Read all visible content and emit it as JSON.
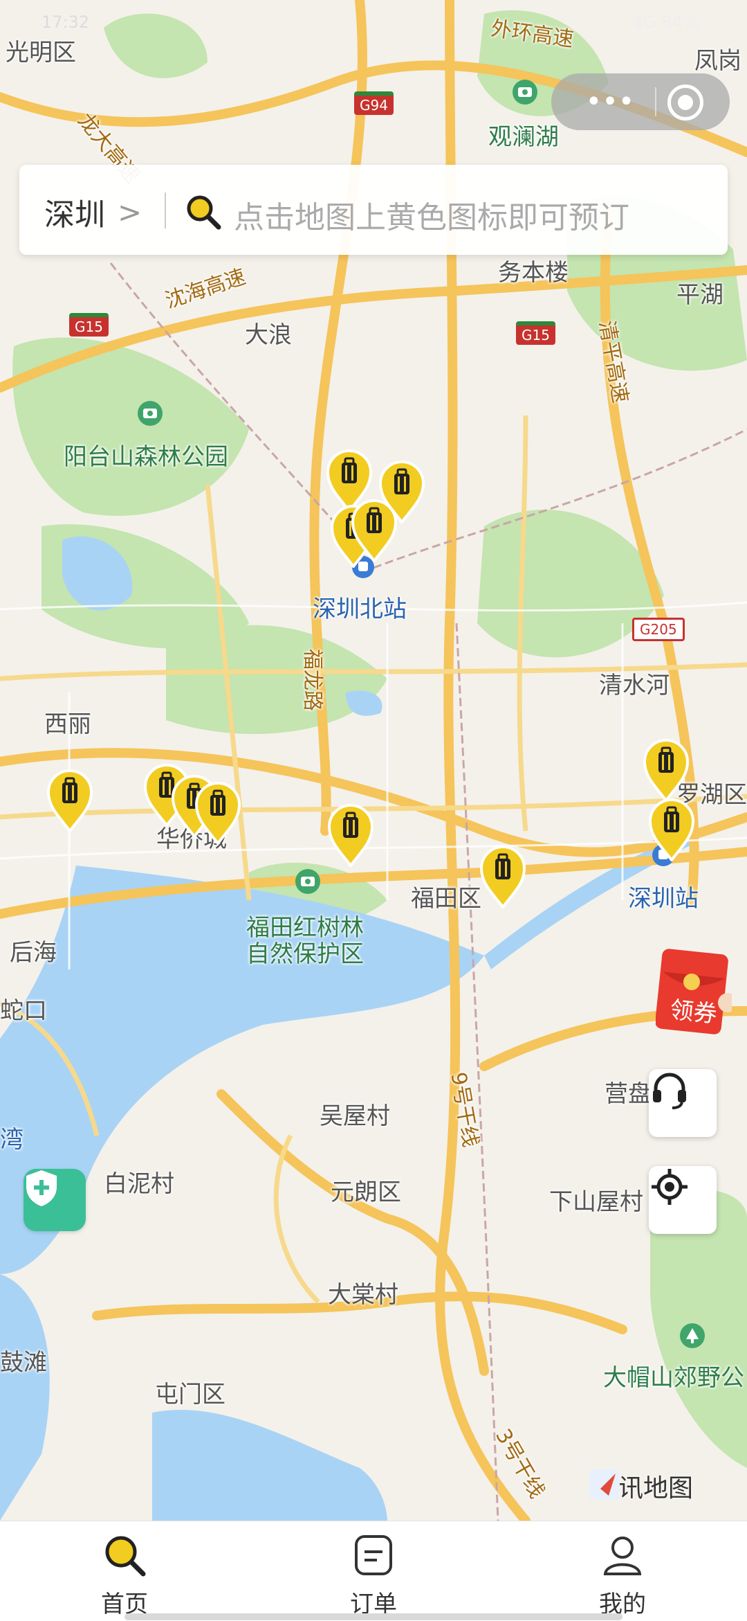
{
  "status_bar": {
    "time": "17:32",
    "right": "4G 84%"
  },
  "capsule": {
    "more_label": "•••"
  },
  "search": {
    "city": "深圳",
    "placeholder": "点击地图上黄色图标即可预订"
  },
  "map": {
    "labels": [
      {
        "text": "光明区",
        "cls": ""
      },
      {
        "text": "凤岗",
        "cls": ""
      },
      {
        "text": "外环高速",
        "cls": "road"
      },
      {
        "text": "观澜湖",
        "cls": "park"
      },
      {
        "text": "龙大高速",
        "cls": "road"
      },
      {
        "text": "务本楼",
        "cls": ""
      },
      {
        "text": "沈海高速",
        "cls": "road"
      },
      {
        "text": "平湖",
        "cls": ""
      },
      {
        "text": "大浪",
        "cls": ""
      },
      {
        "text": "清平高速",
        "cls": "road"
      },
      {
        "text": "阳台山森林公园",
        "cls": "park"
      },
      {
        "text": "深圳北站",
        "cls": "blue"
      },
      {
        "text": "福龙路",
        "cls": "road"
      },
      {
        "text": "清水河",
        "cls": ""
      },
      {
        "text": "西丽",
        "cls": ""
      },
      {
        "text": "罗湖区",
        "cls": ""
      },
      {
        "text": "华侨城",
        "cls": ""
      },
      {
        "text": "福田区",
        "cls": ""
      },
      {
        "text": "深圳站",
        "cls": "blue"
      },
      {
        "text": "福田红树林",
        "cls": "park"
      },
      {
        "text": "自然保护区",
        "cls": "park"
      },
      {
        "text": "后海",
        "cls": ""
      },
      {
        "text": "蛇口",
        "cls": ""
      },
      {
        "text": "吴屋村",
        "cls": ""
      },
      {
        "text": "营盘",
        "cls": ""
      },
      {
        "text": "湾",
        "cls": "blue"
      },
      {
        "text": "白泥村",
        "cls": ""
      },
      {
        "text": "元朗区",
        "cls": ""
      },
      {
        "text": "下山屋村",
        "cls": ""
      },
      {
        "text": "9号干线",
        "cls": "road"
      },
      {
        "text": "大棠村",
        "cls": ""
      },
      {
        "text": "大帽山郊野公",
        "cls": "park"
      },
      {
        "text": "鼓滩",
        "cls": ""
      },
      {
        "text": "屯门区",
        "cls": ""
      },
      {
        "text": "3号干线",
        "cls": "road"
      }
    ],
    "shields": [
      "G94",
      "G15",
      "G15",
      "G205"
    ],
    "marker_count": 12
  },
  "coupon": {
    "label": "领券"
  },
  "map_brand": "腾讯地图",
  "tabs": [
    {
      "label": "首页",
      "active": true
    },
    {
      "label": "订单",
      "active": false
    },
    {
      "label": "我的",
      "active": false
    }
  ],
  "colors": {
    "accent": "#f2cc20",
    "marker_stroke": "#b89a12",
    "water": "#a9d3f5",
    "park": "#b8dfa4",
    "road": "#f7c35c",
    "tab_active": "#f2cc20"
  }
}
